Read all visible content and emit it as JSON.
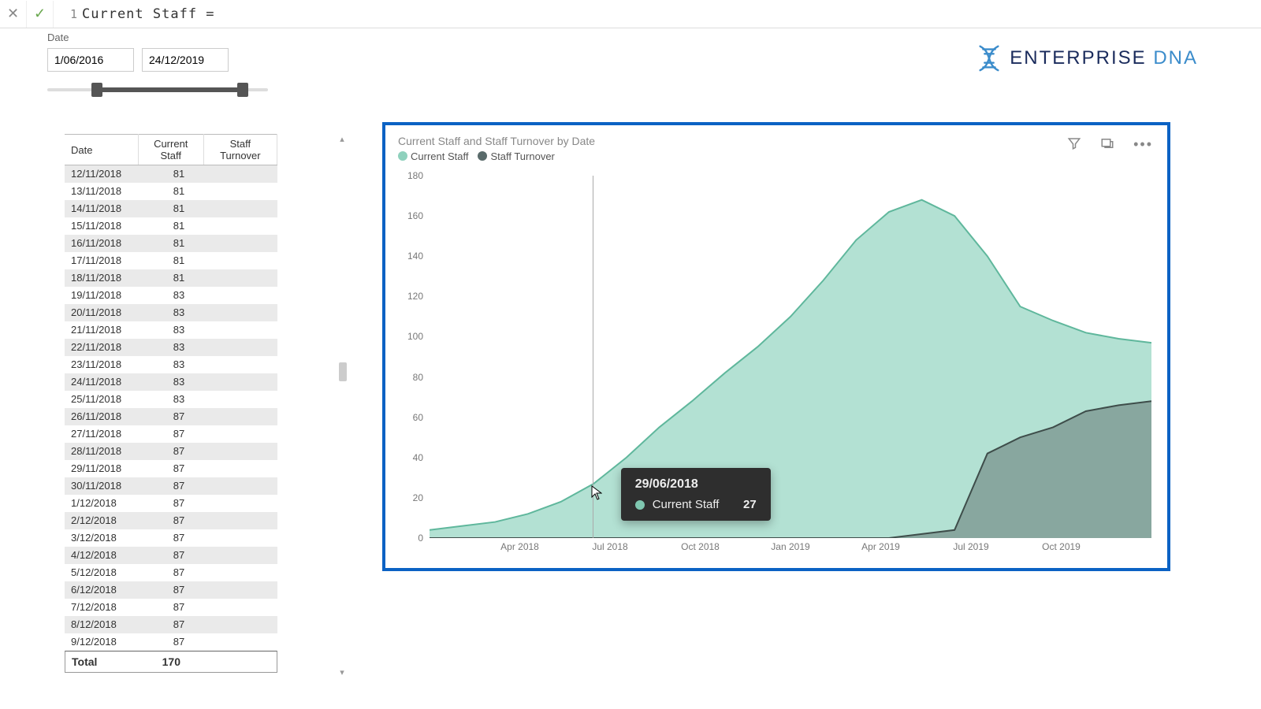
{
  "formula": {
    "line_no": "1",
    "text": "Current Staff ="
  },
  "slicer": {
    "label": "Date",
    "from": "1/06/2016",
    "to": "24/12/2019"
  },
  "logo": {
    "brand1": "ENTERPRISE",
    "brand2": "DNA"
  },
  "table": {
    "headers": [
      "Date",
      "Current Staff",
      "Staff Turnover"
    ],
    "rows": [
      [
        "12/11/2018",
        "81",
        ""
      ],
      [
        "13/11/2018",
        "81",
        ""
      ],
      [
        "14/11/2018",
        "81",
        ""
      ],
      [
        "15/11/2018",
        "81",
        ""
      ],
      [
        "16/11/2018",
        "81",
        ""
      ],
      [
        "17/11/2018",
        "81",
        ""
      ],
      [
        "18/11/2018",
        "81",
        ""
      ],
      [
        "19/11/2018",
        "83",
        ""
      ],
      [
        "20/11/2018",
        "83",
        ""
      ],
      [
        "21/11/2018",
        "83",
        ""
      ],
      [
        "22/11/2018",
        "83",
        ""
      ],
      [
        "23/11/2018",
        "83",
        ""
      ],
      [
        "24/11/2018",
        "83",
        ""
      ],
      [
        "25/11/2018",
        "83",
        ""
      ],
      [
        "26/11/2018",
        "87",
        ""
      ],
      [
        "27/11/2018",
        "87",
        ""
      ],
      [
        "28/11/2018",
        "87",
        ""
      ],
      [
        "29/11/2018",
        "87",
        ""
      ],
      [
        "30/11/2018",
        "87",
        ""
      ],
      [
        "1/12/2018",
        "87",
        ""
      ],
      [
        "2/12/2018",
        "87",
        ""
      ],
      [
        "3/12/2018",
        "87",
        ""
      ],
      [
        "4/12/2018",
        "87",
        ""
      ],
      [
        "5/12/2018",
        "87",
        ""
      ],
      [
        "6/12/2018",
        "87",
        ""
      ],
      [
        "7/12/2018",
        "87",
        ""
      ],
      [
        "8/12/2018",
        "87",
        ""
      ],
      [
        "9/12/2018",
        "87",
        ""
      ]
    ],
    "total_label": "Total",
    "total_value": "170"
  },
  "chart": {
    "title": "Current Staff and Staff Turnover by Date",
    "legend": [
      {
        "label": "Current Staff",
        "color": "#8fd1bd"
      },
      {
        "label": "Staff Turnover",
        "color": "#5a6b6b"
      }
    ],
    "colors": {
      "cs_fill": "#a6dccb",
      "cs_stroke": "#5fb79c",
      "st_fill": "#7a938e",
      "st_stroke": "#3e4d4a"
    },
    "tooltip": {
      "date": "29/06/2018",
      "series": "Current Staff",
      "value": "27"
    }
  },
  "chart_data": {
    "type": "area",
    "title": "Current Staff and Staff Turnover by Date",
    "xlabel": "",
    "ylabel": "",
    "y_ticks": [
      0,
      20,
      40,
      60,
      80,
      100,
      120,
      140,
      160,
      180
    ],
    "x_ticks": [
      "Apr 2018",
      "Jul 2018",
      "Oct 2018",
      "Jan 2019",
      "Apr 2019",
      "Jul 2019",
      "Oct 2019"
    ],
    "ylim": [
      0,
      180
    ],
    "x": [
      "2018-02",
      "2018-03",
      "2018-04",
      "2018-05",
      "2018-06",
      "2018-07",
      "2018-08",
      "2018-09",
      "2018-10",
      "2018-11",
      "2018-12",
      "2019-01",
      "2019-02",
      "2019-03",
      "2019-04",
      "2019-05",
      "2019-06",
      "2019-07",
      "2019-08",
      "2019-09",
      "2019-10",
      "2019-11",
      "2019-12"
    ],
    "series": [
      {
        "name": "Current Staff",
        "values": [
          4,
          6,
          8,
          12,
          18,
          27,
          40,
          55,
          68,
          82,
          95,
          110,
          128,
          148,
          162,
          168,
          160,
          140,
          115,
          108,
          102,
          99,
          97
        ]
      },
      {
        "name": "Staff Turnover",
        "values": [
          0,
          0,
          0,
          0,
          0,
          0,
          0,
          0,
          0,
          0,
          0,
          0,
          0,
          0,
          0,
          2,
          4,
          42,
          50,
          55,
          63,
          66,
          68
        ]
      }
    ],
    "hover_point": {
      "x": "2018-06-29",
      "series": "Current Staff",
      "value": 27
    }
  }
}
